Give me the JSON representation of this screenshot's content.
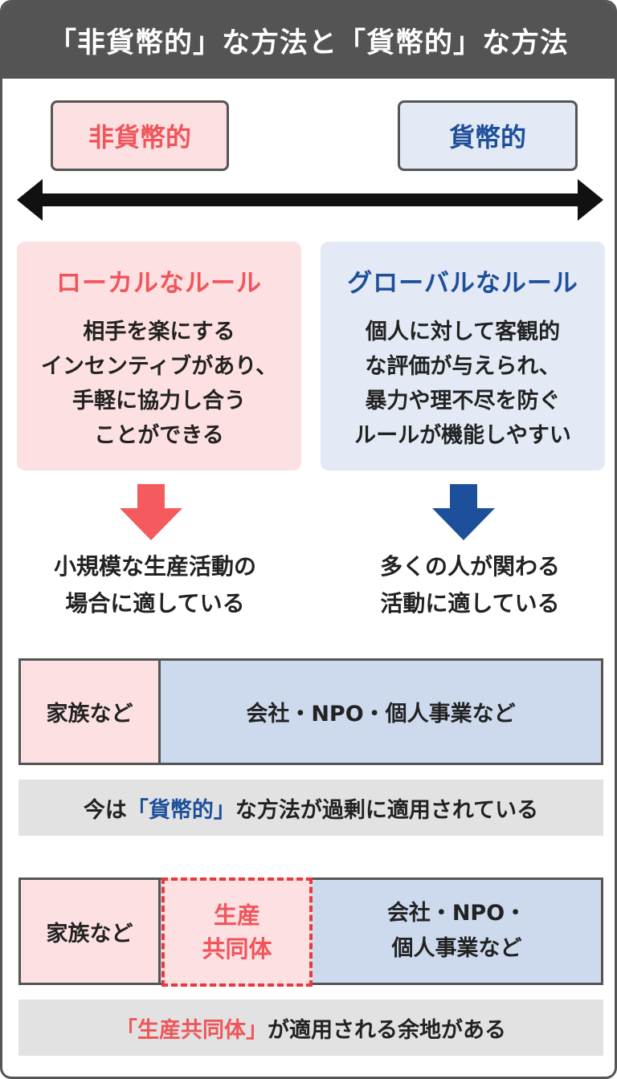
{
  "header": {
    "title": "「非貨幣的」な方法と「貨幣的」な方法"
  },
  "labels": {
    "left": "非貨幣的",
    "right": "貨幣的"
  },
  "rules": {
    "left": {
      "title": "ローカルなルール",
      "lines": [
        "相手を楽にする",
        "インセンティブがあり、",
        "手軽に協力し合う",
        "ことができる"
      ]
    },
    "right": {
      "title": "グローバルなルール",
      "lines": [
        "個人に対して客観的",
        "な評価が与えられ、",
        "暴力や理不尽を防ぐ",
        "ルールが機能しやすい"
      ]
    }
  },
  "results": {
    "left": [
      "小規模な生産活動の",
      "場合に適している"
    ],
    "right": [
      "多くの人が関わる",
      "活動に適している"
    ]
  },
  "bar1": {
    "family": "家族など",
    "company": "会社・NPO・個人事業など"
  },
  "note1": {
    "prefix": "今は",
    "highlight": "「貨幣的」",
    "suffix": "な方法が過剰に適用されている"
  },
  "bar2": {
    "family": "家族など",
    "coop_lines": [
      "生産",
      "共同体"
    ],
    "company_lines": [
      "会社・NPO・",
      "個人事業など"
    ]
  },
  "note2": {
    "highlight": "「生産共同体」",
    "suffix": "が適用される余地がある"
  },
  "colors": {
    "header_bg": "#545454",
    "pink_bg": "#fde0e2",
    "pink_text": "#f0555a",
    "blue_bg": "#e3eaf5",
    "blue_text": "#1d4f9b",
    "bar_blue": "#cddaee",
    "dashed_red": "#e63a3f",
    "note_bg": "#e2e2e2"
  }
}
